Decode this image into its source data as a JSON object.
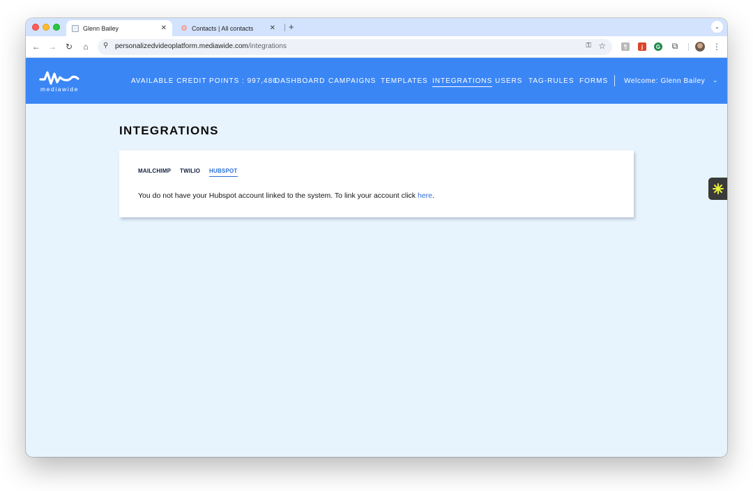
{
  "browser": {
    "tabs": [
      {
        "title": "Glenn Bailey",
        "close": "✕"
      },
      {
        "title": "Contacts | All contacts",
        "close": "✕"
      }
    ],
    "new_tab": "+",
    "tab_menu": "⌄",
    "nav": {
      "back": "←",
      "forward": "→",
      "reload": "↻",
      "home": "⌂"
    },
    "url_host": "personalizedvideoplatform.mediawide.com",
    "url_path": "/integrations",
    "menu": "⋮"
  },
  "app": {
    "logo_text": "mediawide",
    "brand_color": "#3b86f5",
    "nav": [
      {
        "label": "AVAILABLE CREDIT POINTS : 997,486"
      },
      {
        "label": "DASHBOARD"
      },
      {
        "label": "CAMPAIGNS"
      },
      {
        "label": "TEMPLATES"
      },
      {
        "label": "INTEGRATIONS"
      },
      {
        "label": "USERS"
      },
      {
        "label": "TAG-RULES"
      },
      {
        "label": "FORMS"
      }
    ],
    "welcome": "Welcome: Glenn Bailey",
    "welcome_caret": "⌄"
  },
  "page": {
    "title": "INTEGRATIONS",
    "tabs": [
      {
        "label": "MAILCHIMP"
      },
      {
        "label": "TWILIO"
      },
      {
        "label": "HUBSPOT",
        "active": true
      }
    ],
    "message": "You do not have your Hubspot account linked to the system. To link your account click ",
    "link": "here",
    "message_end": "."
  }
}
